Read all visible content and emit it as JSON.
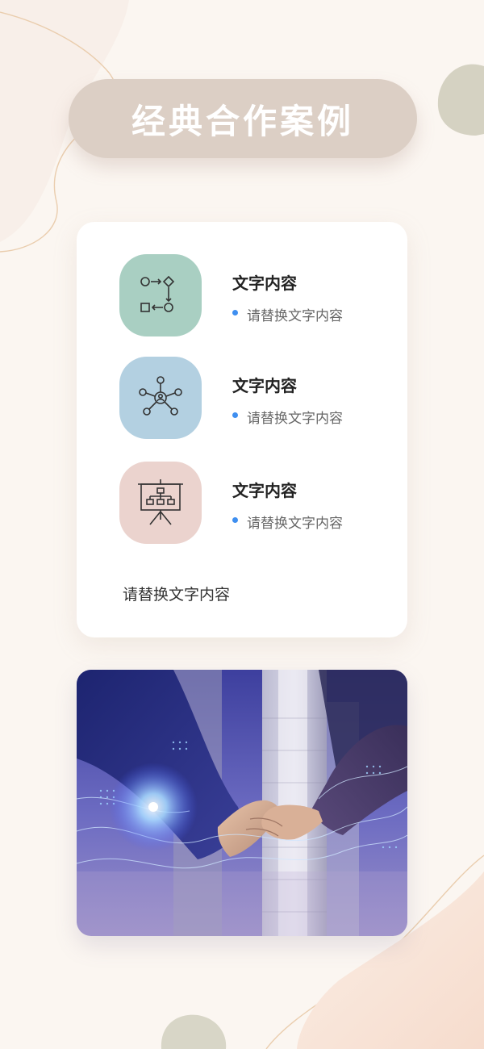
{
  "header": {
    "title": "经典合作案例"
  },
  "card": {
    "items": [
      {
        "title": "文字内容",
        "bullet": "请替换文字内容",
        "icon": "process-flow-icon",
        "tile_color": "#a9cfc2"
      },
      {
        "title": "文字内容",
        "bullet": "请替换文字内容",
        "icon": "network-icon",
        "tile_color": "#b3d0e1"
      },
      {
        "title": "文字内容",
        "bullet": "请替换文字内容",
        "icon": "presentation-board-icon",
        "tile_color": "#ebd3ce"
      }
    ],
    "caption": "请替换文字内容"
  },
  "photo": {
    "subject": "handshake-image"
  },
  "colors": {
    "background": "#fbf6f1",
    "title_pill": "#dccfc5",
    "bullet": "#3f8ff0",
    "blob_green": "#d3d1c1",
    "blob_peach": "#f6ddd0"
  }
}
